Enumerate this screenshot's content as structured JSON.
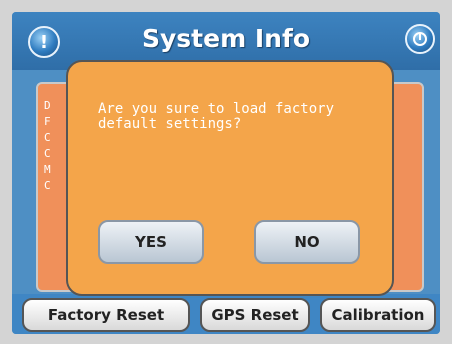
{
  "header": {
    "title": "System Info",
    "info_icon_glyph": "!",
    "power_icon": "power-icon"
  },
  "panel": {
    "partial_line_starts": [
      "D",
      "F",
      "C",
      "C",
      "M",
      "C"
    ]
  },
  "bottom_buttons": {
    "factory_reset": "Factory Reset",
    "gps_reset": "GPS Reset",
    "calibration": "Calibration"
  },
  "dialog": {
    "message": "Are you sure to load factory\ndefault settings?",
    "yes_label": "YES",
    "no_label": "NO"
  },
  "colors": {
    "screen_blue": "#4e8fc4",
    "panel_orange": "#f0905a",
    "dialog_orange": "#f4a54a"
  }
}
